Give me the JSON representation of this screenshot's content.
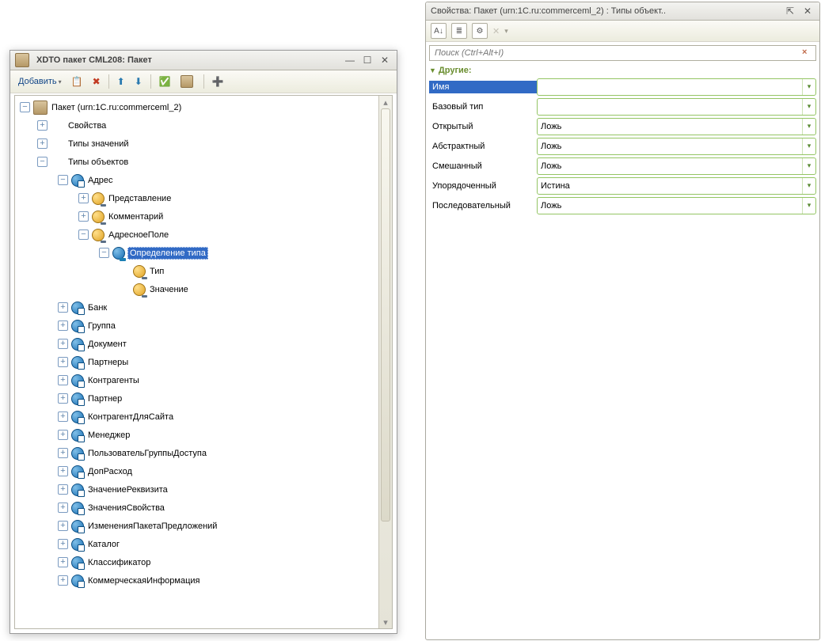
{
  "leftWindow": {
    "title": "XDTO пакет CML208: Пакет",
    "toolbar": {
      "add": "Добавить"
    },
    "tree": {
      "root": {
        "label": "Пакет (urn:1C.ru:commerceml_2)"
      },
      "section_props": "Свойства",
      "section_valtypes": "Типы значений",
      "section_objtypes": "Типы объектов",
      "adres": "Адрес",
      "adres_children": {
        "predstav": "Представление",
        "komment": "Комментарий",
        "adrespole": "АдресноеПоле",
        "typedef": "Определение типа",
        "tip": "Тип",
        "znach": "Значение"
      },
      "obj_list": [
        "Банк",
        "Группа",
        "Документ",
        "Партнеры",
        "Контрагенты",
        "Партнер",
        "КонтрагентДляСайта",
        "Менеджер",
        "ПользовательГруппыДоступа",
        "ДопРасход",
        "ЗначениеРеквизита",
        "ЗначенияСвойства",
        "ИзмененияПакетаПредложений",
        "Каталог",
        "Классификатор",
        "КоммерческаяИнформация"
      ]
    }
  },
  "rightWindow": {
    "title": "Свойства: Пакет (urn:1C.ru:commerceml_2) : Типы объект..",
    "searchPlaceholder": "Поиск (Ctrl+Alt+I)",
    "sectionName": "Другие:",
    "rows": {
      "name": {
        "label": "Имя",
        "value": ""
      },
      "basetype": {
        "label": "Базовый тип",
        "value": ""
      },
      "open": {
        "label": "Открытый",
        "value": "Ложь"
      },
      "abstract": {
        "label": "Абстрактный",
        "value": "Ложь"
      },
      "mixed": {
        "label": "Смешанный",
        "value": "Ложь"
      },
      "ordered": {
        "label": "Упорядоченный",
        "value": "Истина"
      },
      "sequential": {
        "label": "Последовательный",
        "value": "Ложь"
      }
    }
  }
}
